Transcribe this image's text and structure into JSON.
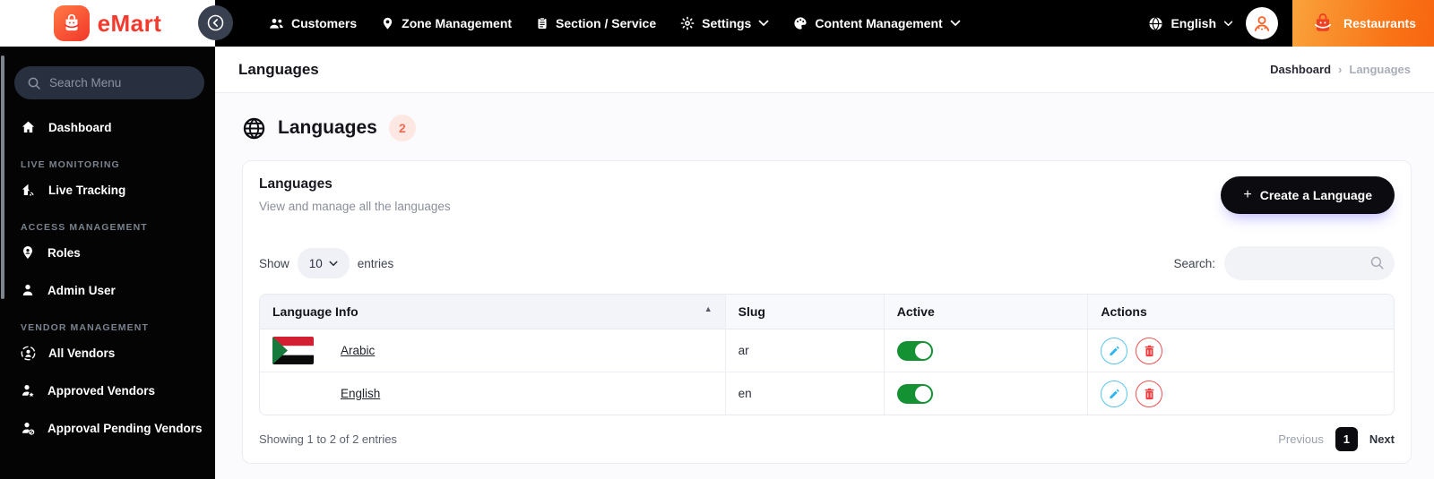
{
  "brand": {
    "name": "eMart"
  },
  "topnav": {
    "items": [
      {
        "label": "Customers"
      },
      {
        "label": "Zone Management"
      },
      {
        "label": "Section / Service"
      },
      {
        "label": "Settings"
      },
      {
        "label": "Content Management"
      }
    ],
    "language": "English",
    "restaurants_label": "Restaurants"
  },
  "sidebar": {
    "search_placeholder": "Search Menu",
    "dashboard_label": "Dashboard",
    "sections": [
      {
        "label": "LIVE MONITORING",
        "items": [
          {
            "label": "Live Tracking"
          }
        ]
      },
      {
        "label": "ACCESS MANAGEMENT",
        "items": [
          {
            "label": "Roles"
          },
          {
            "label": "Admin User"
          }
        ]
      },
      {
        "label": "VENDOR MANAGEMENT",
        "items": [
          {
            "label": "All Vendors"
          },
          {
            "label": "Approved Vendors"
          },
          {
            "label": "Approval Pending Vendors"
          }
        ]
      }
    ]
  },
  "page": {
    "title": "Languages",
    "breadcrumb": {
      "parent": "Dashboard",
      "separator": "›",
      "current": "Languages"
    },
    "heading": "Languages",
    "count_badge": "2"
  },
  "card": {
    "title": "Languages",
    "subtitle": "View and manage all the languages",
    "create_plus": "+",
    "create_button_label": "Create a Language",
    "show_label": "Show",
    "show_value": "10",
    "entries_label": "entries",
    "search_label": "Search:",
    "table": {
      "headers": [
        "Language Info",
        "Slug",
        "Active",
        "Actions"
      ],
      "sort_asc_icon": "▲",
      "rows": [
        {
          "name": "Arabic",
          "slug": "ar",
          "active": true,
          "flag": "sudan"
        },
        {
          "name": "English",
          "slug": "en",
          "active": true,
          "flag": null
        }
      ]
    },
    "footer": {
      "summary": "Showing 1 to 2 of 2 entries",
      "previous": "Previous",
      "page": "1",
      "next": "Next"
    }
  },
  "colors": {
    "brand_red": "#f43a2c",
    "restaurants_orange": "#f97316",
    "toggle_green": "#149233",
    "edit_blue": "#2eb5f0",
    "delete_red": "#f23d3d",
    "badge_bg": "#fde7e2",
    "badge_text": "#ee6a52",
    "topbar_black": "#000000"
  }
}
